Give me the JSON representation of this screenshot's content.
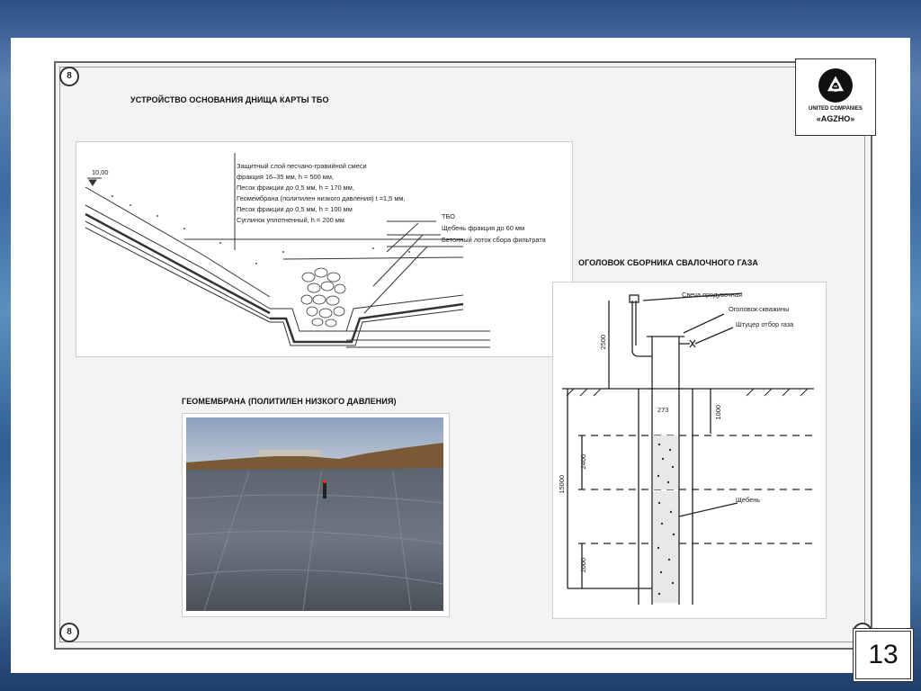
{
  "page": {
    "number": "13",
    "marker_label": "8"
  },
  "logo": {
    "line1": "UNITED COMPANIES",
    "line2": "«AGZHO»",
    "icon": "recycle-icon"
  },
  "section1": {
    "title": "УСТРОЙСТВО ОСНОВАНИЯ ДНИЩА КАРТЫ ТБО",
    "elevation": "10,00",
    "layers": [
      "Защитный слой песчано-гравийной смеси",
      "фракция 16–35 мм, h = 500 мм,",
      "Песок фракции до 0,5 мм, h = 170 мм,",
      "Геомембрана (политилен низкого давления) t =1,5 мм,",
      "Песок фракции до 0,5 мм, h = 100 мм",
      "Суглинок уплотненный, h = 200 мм"
    ],
    "callouts": [
      "ТБО",
      "Щебень фракция до 60 мм",
      "Бетонный лоток сбора фильтрата"
    ]
  },
  "section2": {
    "title": "ОГОЛОВОК СБОРНИКА СВАЛОЧНОГО ГАЗА",
    "labels": [
      "Свеча продувочная",
      "Оголовок скважины",
      "Штуцер отбор газа",
      "Щебень"
    ],
    "dims": [
      "2500",
      "1000",
      "2400",
      "15000",
      "2000",
      "273"
    ]
  },
  "section3": {
    "title": "ГЕОМЕМБРАНА (ПОЛИТИЛЕН НИЗКОГО ДАВЛЕНИЯ)"
  },
  "colors": {
    "frame": "#666666",
    "sky": "#9fb0c8",
    "membrane": "#4e5560"
  }
}
